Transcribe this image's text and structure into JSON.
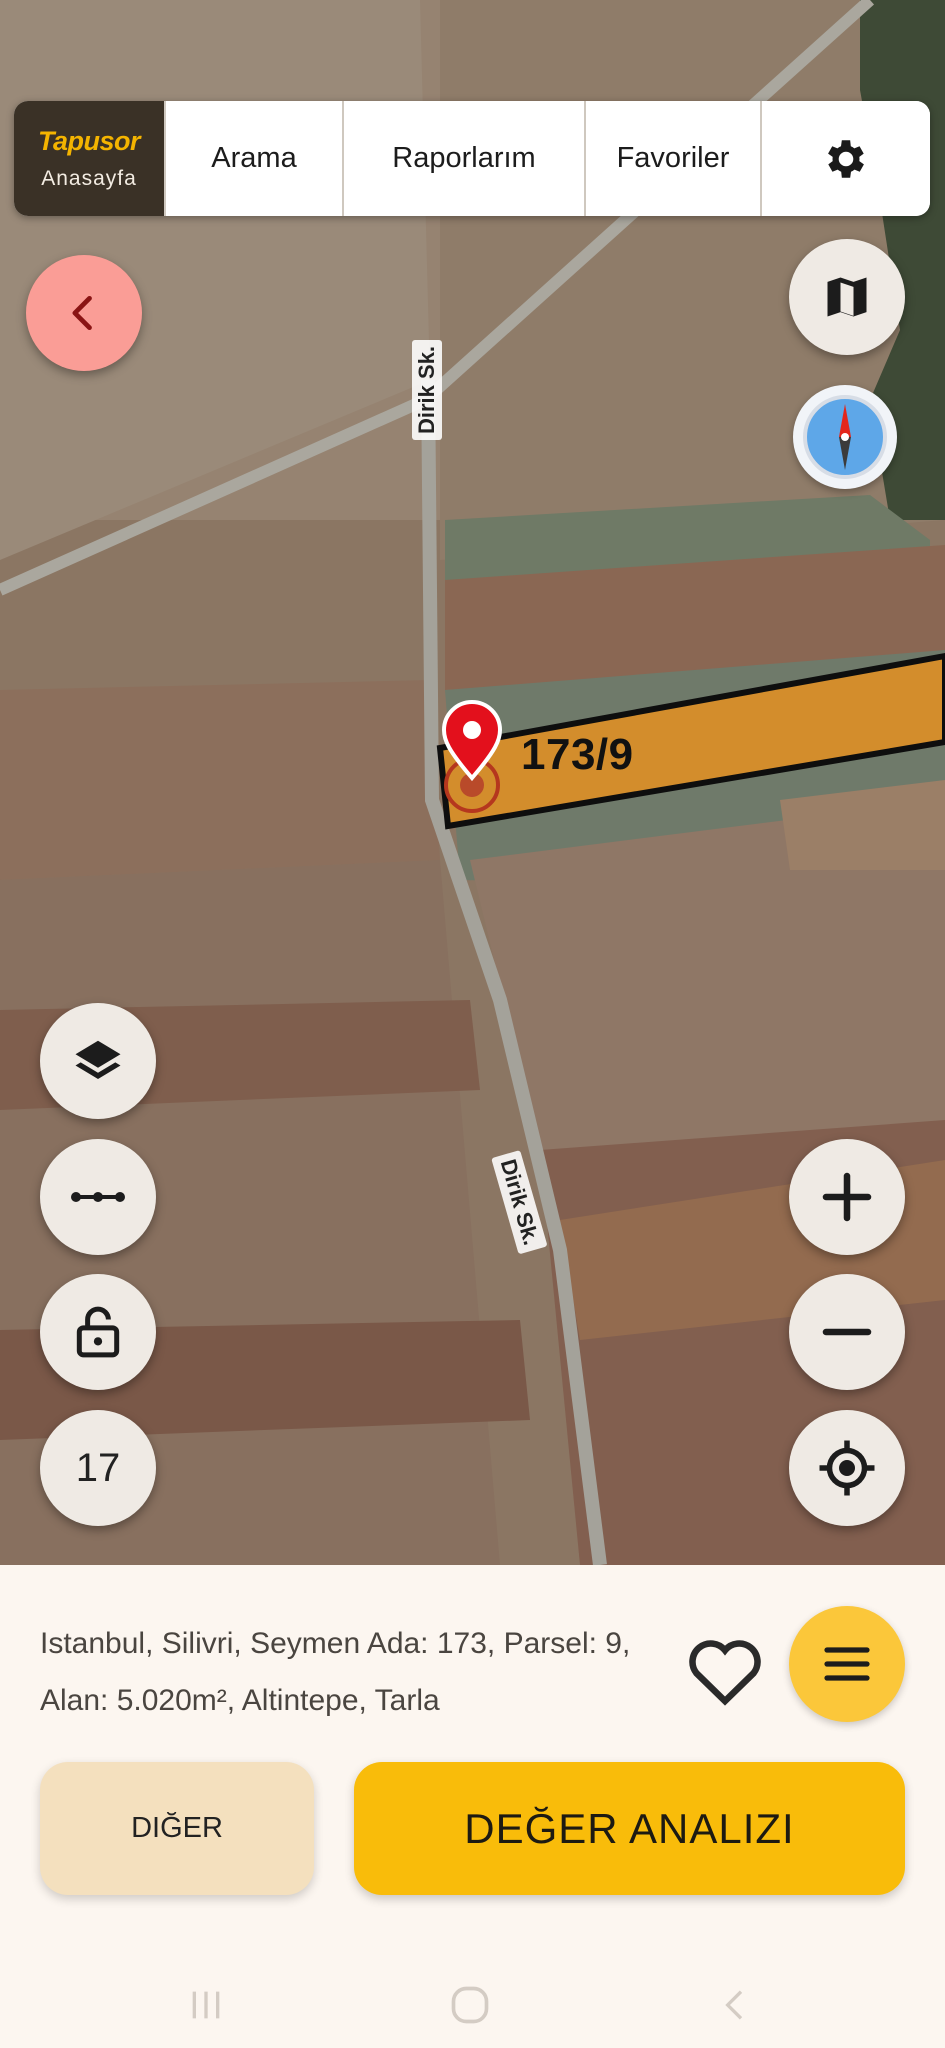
{
  "nav": {
    "brand": "Tapusor",
    "brand_sub": "Anasayfa",
    "items": [
      "Arama",
      "Raporlarım",
      "Favoriler"
    ],
    "settings_icon": "gear-icon"
  },
  "map": {
    "parcel_label": "173/9",
    "street_names": [
      "Dirik Sk.",
      "Dirik Sk."
    ],
    "zoom_level": "17",
    "colors": {
      "parcel_fill": "#d38d2c",
      "marker": "#e3101c",
      "accent": "#f9bc0a"
    }
  },
  "info": {
    "address": "Istanbul, Silivri, Seymen Ada: 173, Parsel: 9, Alan: 5.020m², Altintepe, Tarla"
  },
  "buttons": {
    "other": "DIĞER",
    "value_analysis": "DEĞER ANALIZI"
  }
}
